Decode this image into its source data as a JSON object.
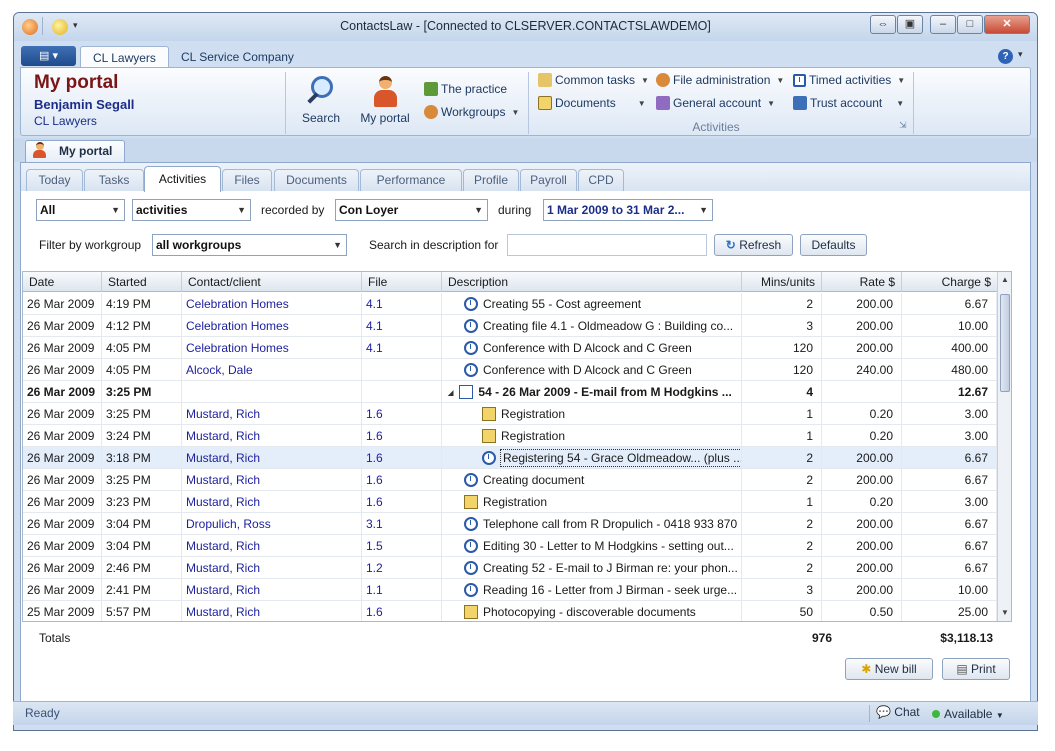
{
  "window": {
    "title": "ContactsLaw - [Connected to CLSERVER.CONTACTSLAWDEMO]"
  },
  "ribbon_tabs": [
    "CL Lawyers",
    "CL Service Company"
  ],
  "portal": {
    "title": "My portal",
    "user": "Benjamin Segall",
    "firm": "CL Lawyers"
  },
  "ribbon": {
    "search": "Search",
    "my_portal": "My portal",
    "the_practice": "The practice",
    "workgroups": "Workgroups",
    "common_tasks": "Common tasks",
    "documents": "Documents",
    "file_administration": "File administration",
    "general_account": "General account",
    "timed_activities": "Timed activities",
    "trust_account": "Trust account",
    "activities_group": "Activities"
  },
  "doc_tab": "My portal",
  "sub_tabs": [
    "Today",
    "Tasks",
    "Activities",
    "Files",
    "Documents",
    "Performance",
    "Profile",
    "Payroll",
    "CPD"
  ],
  "active_sub_tab": "Activities",
  "filters": {
    "scope": "All",
    "type": "activities",
    "recorded_by_label": "recorded by",
    "recorded_by": "Con Loyer",
    "during_label": "during",
    "period": "1 Mar 2009  to 31 Mar 2...",
    "workgroup_label": "Filter by workgroup",
    "workgroup": "all workgroups",
    "search_label": "Search in description for",
    "search_value": "",
    "refresh": "Refresh",
    "defaults": "Defaults"
  },
  "columns": [
    "Date",
    "Started",
    "Contact/client",
    "File",
    "Description",
    "Mins/units",
    "Rate $",
    "Charge $"
  ],
  "rows": [
    {
      "date": "26 Mar 2009",
      "started": "4:19 PM",
      "contact": "Celebration Homes",
      "file": "4.1",
      "icon": "clock",
      "desc": "Creating 55 - Cost agreement",
      "mins": "2",
      "rate": "200.00",
      "charge": "6.67"
    },
    {
      "date": "26 Mar 2009",
      "started": "4:12 PM",
      "contact": "Celebration Homes",
      "file": "4.1",
      "icon": "clock",
      "desc": "Creating file 4.1 - Oldmeadow G : Building co...",
      "mins": "3",
      "rate": "200.00",
      "charge": "10.00"
    },
    {
      "date": "26 Mar 2009",
      "started": "4:05 PM",
      "contact": "Celebration Homes",
      "file": "4.1",
      "icon": "clock",
      "desc": "Conference with D Alcock and C Green",
      "mins": "120",
      "rate": "200.00",
      "charge": "400.00"
    },
    {
      "date": "26 Mar 2009",
      "started": "4:05 PM",
      "contact": "Alcock, Dale",
      "file": "",
      "icon": "clock",
      "desc": "Conference with D Alcock and C Green",
      "mins": "120",
      "rate": "240.00",
      "charge": "480.00"
    },
    {
      "date": "26 Mar 2009",
      "started": "3:25 PM",
      "contact": "",
      "file": "",
      "icon": "doc",
      "desc": "54 - 26 Mar 2009 - E-mail from M Hodgkins ...",
      "mins": "4",
      "rate": "",
      "charge": "12.67",
      "group": true
    },
    {
      "date": "26 Mar 2009",
      "started": "3:25 PM",
      "contact": "Mustard, Rich",
      "file": "1.6",
      "icon": "reg",
      "desc": "Registration",
      "mins": "1",
      "rate": "0.20",
      "charge": "3.00",
      "child": true
    },
    {
      "date": "26 Mar 2009",
      "started": "3:24 PM",
      "contact": "Mustard, Rich",
      "file": "1.6",
      "icon": "reg",
      "desc": "Registration",
      "mins": "1",
      "rate": "0.20",
      "charge": "3.00",
      "child": true
    },
    {
      "date": "26 Mar 2009",
      "started": "3:18 PM",
      "contact": "Mustard, Rich",
      "file": "1.6",
      "icon": "clock",
      "desc": "Registering 54 - Grace Oldmeadow... (plus ...",
      "mins": "2",
      "rate": "200.00",
      "charge": "6.67",
      "child": true,
      "selected": true
    },
    {
      "date": "26 Mar 2009",
      "started": "3:25 PM",
      "contact": "Mustard, Rich",
      "file": "1.6",
      "icon": "clock",
      "desc": "Creating document",
      "mins": "2",
      "rate": "200.00",
      "charge": "6.67"
    },
    {
      "date": "26 Mar 2009",
      "started": "3:23 PM",
      "contact": "Mustard, Rich",
      "file": "1.6",
      "icon": "reg",
      "desc": "Registration",
      "mins": "1",
      "rate": "0.20",
      "charge": "3.00"
    },
    {
      "date": "26 Mar 2009",
      "started": "3:04 PM",
      "contact": "Dropulich, Ross",
      "file": "3.1",
      "icon": "clock",
      "desc": "Telephone call from R Dropulich - 0418 933 870",
      "mins": "2",
      "rate": "200.00",
      "charge": "6.67"
    },
    {
      "date": "26 Mar 2009",
      "started": "3:04 PM",
      "contact": "Mustard, Rich",
      "file": "1.5",
      "icon": "clock",
      "desc": "Editing 30 - Letter to M Hodgkins - setting out...",
      "mins": "2",
      "rate": "200.00",
      "charge": "6.67"
    },
    {
      "date": "26 Mar 2009",
      "started": "2:46 PM",
      "contact": "Mustard, Rich",
      "file": "1.2",
      "icon": "clock",
      "desc": "Creating 52 - E-mail to J Birman re: your phon...",
      "mins": "2",
      "rate": "200.00",
      "charge": "6.67"
    },
    {
      "date": "26 Mar 2009",
      "started": "2:41 PM",
      "contact": "Mustard, Rich",
      "file": "1.1",
      "icon": "clock",
      "desc": "Reading 16 - Letter from J Birman - seek urge...",
      "mins": "3",
      "rate": "200.00",
      "charge": "10.00"
    },
    {
      "date": "25 Mar 2009",
      "started": "5:57 PM",
      "contact": "Mustard, Rich",
      "file": "1.6",
      "icon": "reg",
      "desc": "Photocopying - discoverable documents",
      "mins": "50",
      "rate": "0.50",
      "charge": "25.00"
    }
  ],
  "totals": {
    "label": "Totals",
    "mins": "976",
    "charge": "$3,118.13"
  },
  "actions": {
    "new_bill": "New bill",
    "print": "Print"
  },
  "status": {
    "text": "Ready",
    "chat": "Chat",
    "availability": "Available"
  }
}
